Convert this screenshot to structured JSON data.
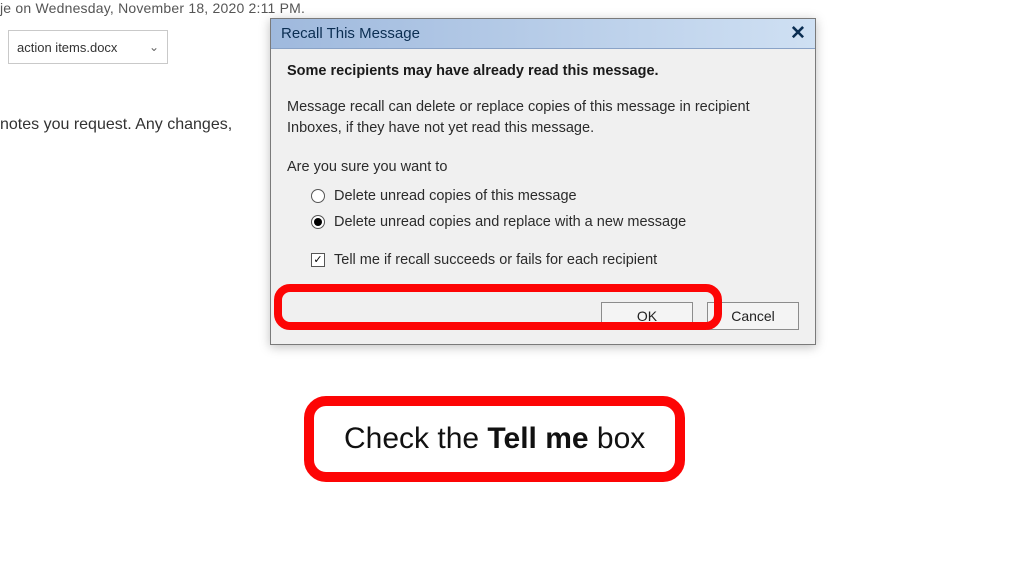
{
  "background": {
    "top_text": "je on Wednesday, November 18, 2020 2:11 PM.",
    "attachment_name": "action items.docx",
    "body_fragment": "notes you request. Any changes,"
  },
  "dialog": {
    "title": "Recall This Message",
    "warning": "Some recipients may have already read this message.",
    "explain": "Message recall can delete or replace copies of this message in recipient Inboxes, if they have not yet read this message.",
    "prompt": "Are you sure you want to",
    "option_delete": "Delete unread copies of this message",
    "option_replace": "Delete unread copies and replace with a new message",
    "tell_me": "Tell me if recall succeeds or fails for each recipient",
    "ok": "OK",
    "cancel": "Cancel"
  },
  "callout": {
    "pre": "Check the ",
    "bold": "Tell me",
    "post": " box"
  }
}
